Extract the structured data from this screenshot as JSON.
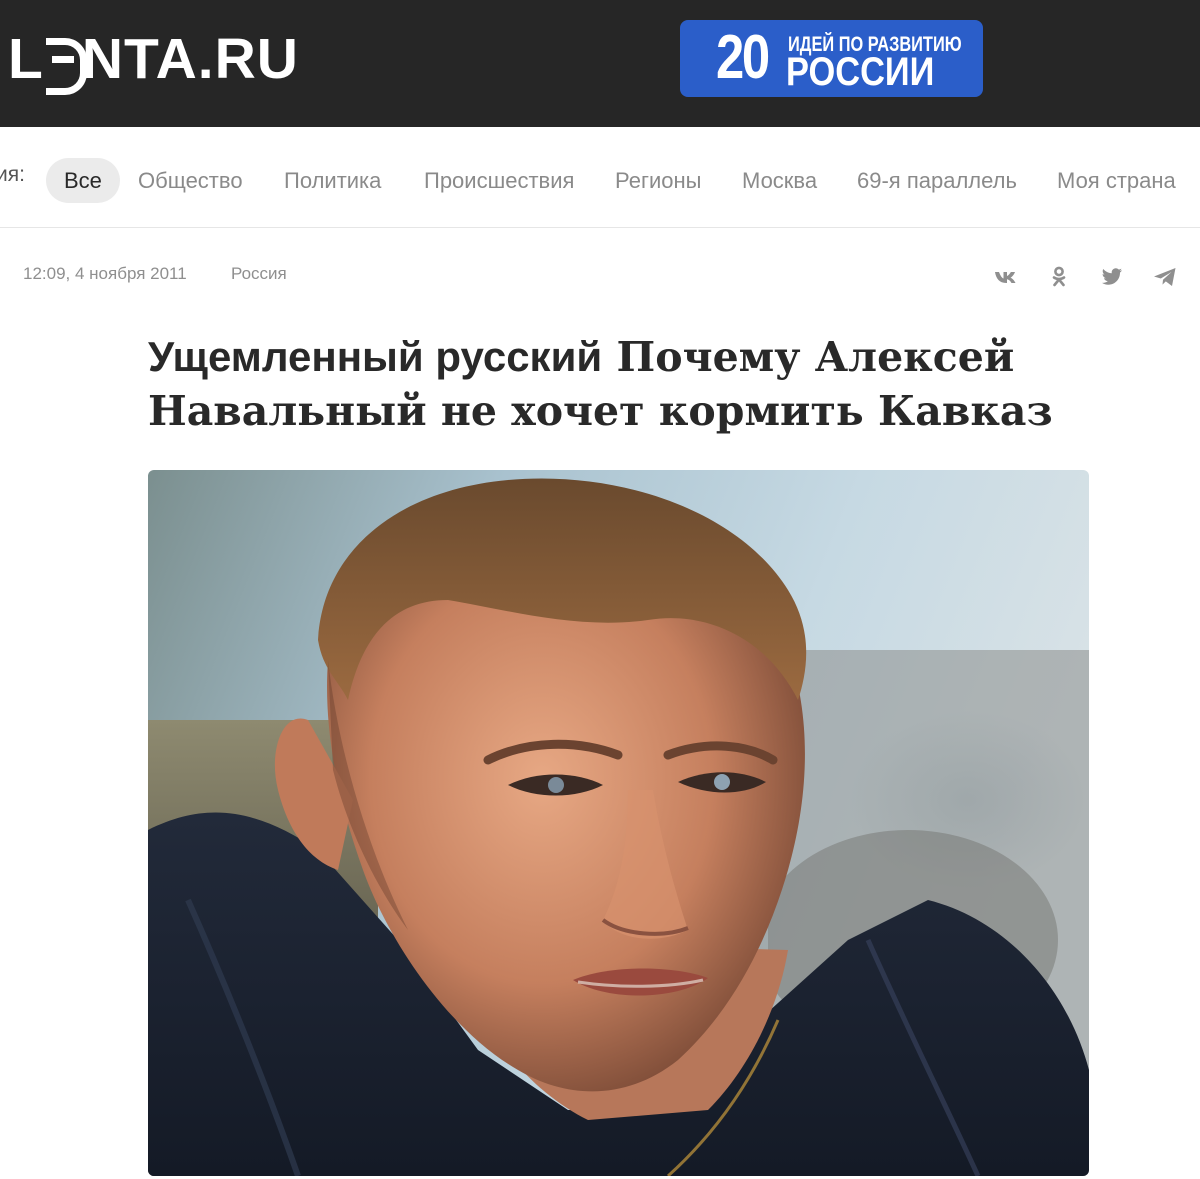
{
  "header": {
    "logo_text": "LENTA.RU",
    "logo_parts": [
      "L",
      "NTA.RU"
    ],
    "background": "#262626",
    "promo": {
      "number": "20",
      "line1": "ИДЕЙ ПО РАЗВИТИЮ",
      "line2": "РОССИИ",
      "color": "#2b5ec9"
    }
  },
  "subnav": {
    "label": "ия:",
    "items": [
      {
        "label": "Все",
        "active": true
      },
      {
        "label": "Общество"
      },
      {
        "label": "Политика"
      },
      {
        "label": "Происшествия"
      },
      {
        "label": "Регионы"
      },
      {
        "label": "Москва"
      },
      {
        "label": "69-я параллель"
      },
      {
        "label": "Моя страна"
      }
    ]
  },
  "article": {
    "date": "12:09, 4 ноября 2011",
    "rubric": "Россия",
    "title_lead": "Ущемленный русский",
    "title_rest": "Почему Алексей Навальный не хочет кормить Кавказ",
    "share_icons": [
      "vk-icon",
      "odnoklassniki-icon",
      "twitter-icon",
      "telegram-icon"
    ]
  }
}
